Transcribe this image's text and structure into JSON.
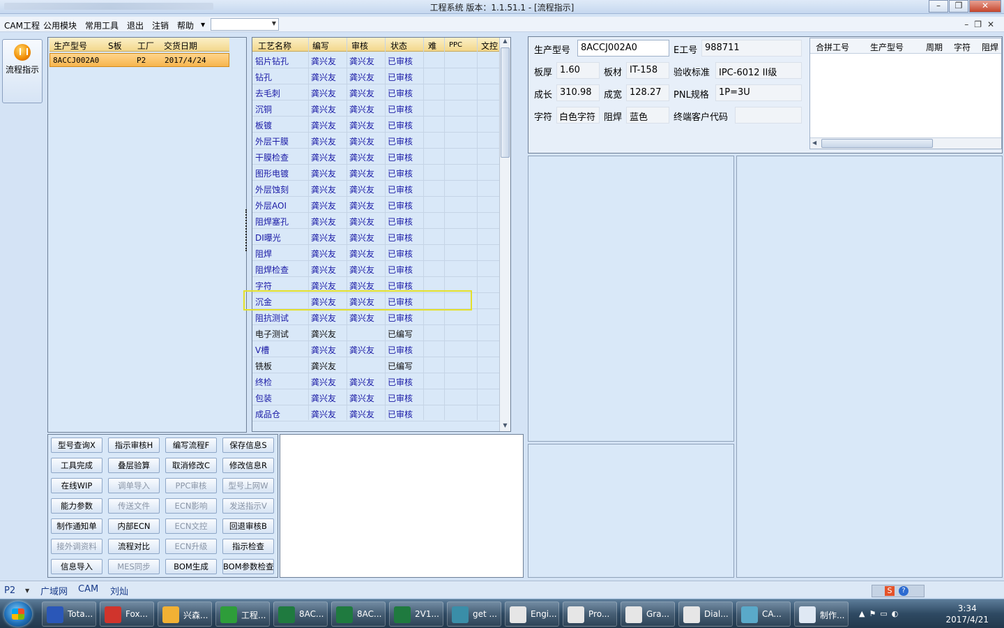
{
  "window": {
    "title": "工程系统   版本：1.1.51.1 - [流程指示]"
  },
  "menu": {
    "items": [
      "CAM工程",
      "公用模块",
      "常用工具",
      "退出",
      "注销",
      "帮助"
    ]
  },
  "left_tool": {
    "label": "流程指示"
  },
  "product_list": {
    "headers": [
      "生产型号",
      "S板",
      "工厂",
      "交货日期"
    ],
    "rows": [
      {
        "model": "8ACCJ002A0",
        "sboard": "",
        "factory": "P2",
        "date": "2017/4/24"
      }
    ]
  },
  "process_table": {
    "headers": [
      "工艺名称",
      "编写",
      "审核",
      "状态",
      "难",
      "PPC",
      "文控"
    ],
    "rows": [
      {
        "name": "铝片钻孔",
        "writer": "龚兴友",
        "reviewer": "龚兴友",
        "status": "已审核"
      },
      {
        "name": "钻孔",
        "writer": "龚兴友",
        "reviewer": "龚兴友",
        "status": "已审核"
      },
      {
        "name": "去毛刺",
        "writer": "龚兴友",
        "reviewer": "龚兴友",
        "status": "已审核"
      },
      {
        "name": "沉铜",
        "writer": "龚兴友",
        "reviewer": "龚兴友",
        "status": "已审核"
      },
      {
        "name": "板镀",
        "writer": "龚兴友",
        "reviewer": "龚兴友",
        "status": "已审核"
      },
      {
        "name": "外层干膜",
        "writer": "龚兴友",
        "reviewer": "龚兴友",
        "status": "已审核"
      },
      {
        "name": "干膜检查",
        "writer": "龚兴友",
        "reviewer": "龚兴友",
        "status": "已审核"
      },
      {
        "name": "图形电镀",
        "writer": "龚兴友",
        "reviewer": "龚兴友",
        "status": "已审核"
      },
      {
        "name": "外层蚀刻",
        "writer": "龚兴友",
        "reviewer": "龚兴友",
        "status": "已审核"
      },
      {
        "name": "外层AOI",
        "writer": "龚兴友",
        "reviewer": "龚兴友",
        "status": "已审核"
      },
      {
        "name": "阻焊塞孔",
        "writer": "龚兴友",
        "reviewer": "龚兴友",
        "status": "已审核"
      },
      {
        "name": "DI曝光",
        "writer": "龚兴友",
        "reviewer": "龚兴友",
        "status": "已审核"
      },
      {
        "name": "阻焊",
        "writer": "龚兴友",
        "reviewer": "龚兴友",
        "status": "已审核"
      },
      {
        "name": "阻焊检查",
        "writer": "龚兴友",
        "reviewer": "龚兴友",
        "status": "已审核"
      },
      {
        "name": "字符",
        "writer": "龚兴友",
        "reviewer": "龚兴友",
        "status": "已审核"
      },
      {
        "name": "沉金",
        "writer": "龚兴友",
        "reviewer": "龚兴友",
        "status": "已审核"
      },
      {
        "name": "阻抗测试",
        "writer": "龚兴友",
        "reviewer": "龚兴友",
        "status": "已审核"
      },
      {
        "name": "电子测试",
        "writer": "龚兴友",
        "reviewer": "",
        "status": "已编写"
      },
      {
        "name": "V槽",
        "writer": "龚兴友",
        "reviewer": "龚兴友",
        "status": "已审核"
      },
      {
        "name": "铣板",
        "writer": "龚兴友",
        "reviewer": "",
        "status": "已编写"
      },
      {
        "name": "终检",
        "writer": "龚兴友",
        "reviewer": "龚兴友",
        "status": "已审核"
      },
      {
        "name": "包装",
        "writer": "龚兴友",
        "reviewer": "龚兴友",
        "status": "已审核"
      },
      {
        "name": "成品仓",
        "writer": "龚兴友",
        "reviewer": "龚兴友",
        "status": "已审核"
      }
    ]
  },
  "buttons": [
    [
      "型号查询X",
      "指示审核H",
      "编写流程F",
      "保存信息S"
    ],
    [
      "工具完成",
      "叠层验算",
      "取消修改C",
      "修改信息R"
    ],
    [
      "在线WIP",
      "调单导入",
      "PPC审核",
      "型号上网W"
    ],
    [
      "能力参数",
      "传送文件",
      "ECN影响",
      "发送指示V"
    ],
    [
      "制作通知单",
      "内部ECN",
      "ECN文控",
      "回退审核B"
    ],
    [
      "接外调资料",
      "流程对比",
      "ECN升级",
      "指示检查"
    ],
    [
      "信息导入",
      "MES同步",
      "BOM生成",
      "BOM参数检查"
    ]
  ],
  "info": {
    "model_label": "生产型号",
    "model_value": "8ACCJ002A0",
    "ework_label": "E工号",
    "ework_value": "988711",
    "thickness_label": "板厚",
    "thickness_value": "1.60",
    "material_label": "板材",
    "material_value": "IT-158",
    "standard_label": "验收标准",
    "standard_value": "IPC-6012 II级",
    "length_label": "成长",
    "length_value": "310.98",
    "width_label": "成宽",
    "width_value": "128.27",
    "pnl_label": "PNL规格",
    "pnl_value": "1P=3U",
    "char_label": "字符",
    "char_value": "白色字符",
    "mask_label": "阻焊",
    "mask_value": "蓝色",
    "customer_label": "终端客户代码",
    "customer_value": ""
  },
  "subgrid_headers": [
    "合拼工号",
    "生产型号",
    "周期",
    "字符",
    "阻焊"
  ],
  "status_bar": {
    "factory": "P2",
    "segments": [
      "广域网",
      "CAM",
      "刘灿"
    ]
  },
  "taskbar": {
    "items": [
      "Tota...",
      "Fox...",
      "兴森...",
      "工程...",
      "8AC...",
      "8AC...",
      "2V1...",
      "get ...",
      "Engi...",
      "Pro...",
      "Gra...",
      "Dial...",
      "CA...",
      "制作..."
    ],
    "time": "3:34",
    "date": "2017/4/21"
  },
  "colors": {
    "accent": "#f7b54e",
    "link_text": "#1a1aa6",
    "highlight_box": "#e4e02a"
  }
}
